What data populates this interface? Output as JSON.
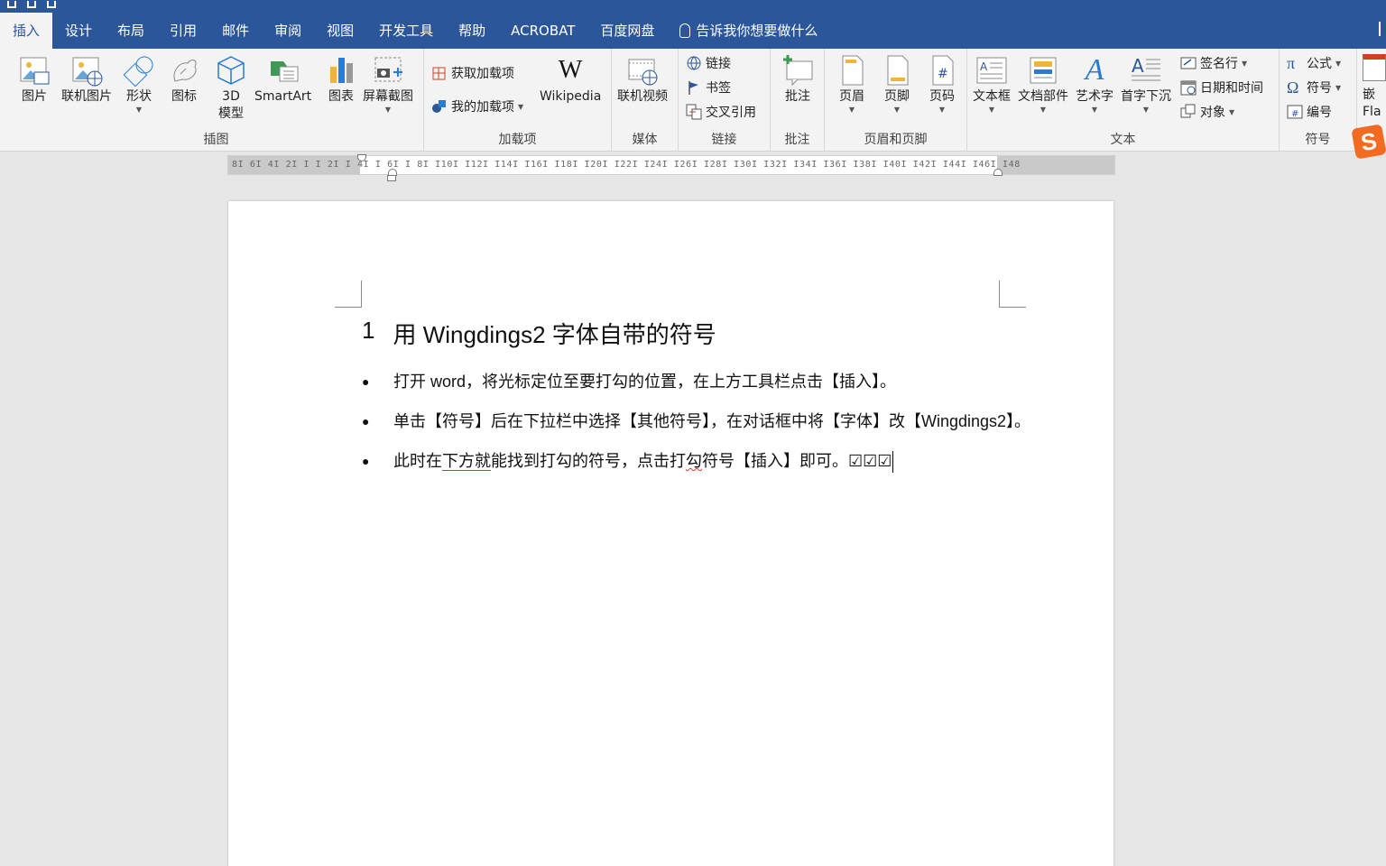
{
  "tabs": [
    {
      "label": "插入",
      "active": true
    },
    {
      "label": "设计"
    },
    {
      "label": "布局"
    },
    {
      "label": "引用"
    },
    {
      "label": "邮件"
    },
    {
      "label": "审阅"
    },
    {
      "label": "视图"
    },
    {
      "label": "开发工具"
    },
    {
      "label": "帮助"
    },
    {
      "label": "ACROBAT"
    },
    {
      "label": "百度网盘"
    }
  ],
  "tell_me": "告诉我你想要做什么",
  "ribbon": {
    "illustrations": {
      "label": "插图",
      "picture": "图片",
      "online_picture": "联机图片",
      "shapes": "形状",
      "icons": "图标",
      "model3d_line1": "3D",
      "model3d_line2": "模型",
      "smartart": "SmartArt",
      "chart": "图表",
      "screenshot": "屏幕截图"
    },
    "addins": {
      "label": "加载项",
      "get_addins": "获取加载项",
      "my_addins": "我的加载项",
      "wikipedia": "Wikipedia"
    },
    "media": {
      "label": "媒体",
      "online_video": "联机视频"
    },
    "links": {
      "label": "链接",
      "link": "链接",
      "bookmark": "书签",
      "cross_ref": "交叉引用"
    },
    "comments": {
      "label": "批注",
      "comment": "批注"
    },
    "header_footer": {
      "label": "页眉和页脚",
      "header": "页眉",
      "footer": "页脚",
      "page_number": "页码"
    },
    "text": {
      "label": "文本",
      "textbox": "文本框",
      "quick_parts": "文档部件",
      "wordart": "艺术字",
      "dropcap": "首字下沉",
      "signature": "签名行",
      "datetime": "日期和时间",
      "object": "对象"
    },
    "symbols": {
      "label": "符号",
      "equation": "公式",
      "symbol": "符号",
      "number": "编号"
    },
    "embed_line1": "嵌",
    "embed_line2": "Fla"
  },
  "ruler": {
    "ticks": "8I  6I  4I  2I  I  I 2I  I 4I  I 6I  I 8I  I10I  I12I  I14I  I16I  I18I  I20I  I22I  I24I  I26I  I28I  I30I  I32I  I34I  I36I  I38I  I40I  I42I  I44I  I46I  I48"
  },
  "document": {
    "heading_number": "1",
    "heading_text": "用 Wingdings2 字体自带的符号",
    "bullets": [
      {
        "parts": [
          "打开 word，将光标定位至要打勾的位置，在上方工具栏点击【插入】。"
        ]
      },
      {
        "parts": [
          "单击【符号】后在下拉栏中选择【其他符号】，在对话框中将【字体】改【Wingdings2】。"
        ]
      },
      {
        "parts": [
          "此时在",
          "下方就",
          "能找到打勾的符号，点击打",
          "勾",
          "符号【插入】即可。☑☑☑"
        ]
      }
    ],
    "bullet_glyph": "●"
  },
  "ime_logo": "S"
}
